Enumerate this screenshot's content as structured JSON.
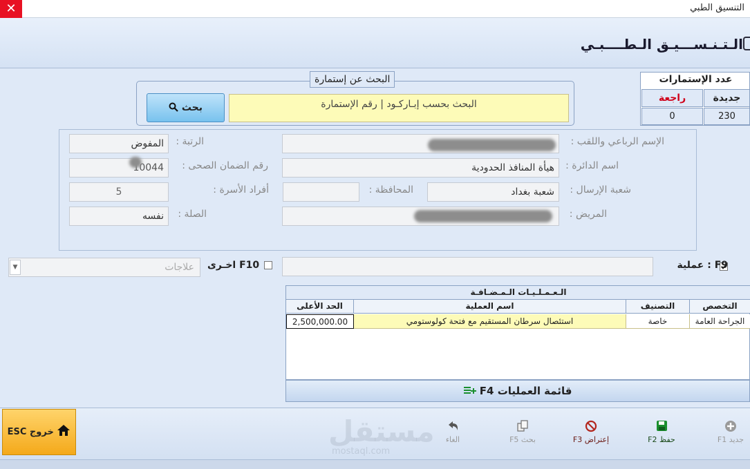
{
  "window": {
    "title": "التنسيق الطبي",
    "close_glyph": "✕"
  },
  "header": {
    "page_title": "الـتـنـســـيـق الـطــــبـي"
  },
  "form_count": {
    "title": "عدد الإستمارات",
    "new_label": "جديدة",
    "returned_label": "راجعة",
    "new_value": "230",
    "returned_value": "0",
    "returned_color": "#d0021b"
  },
  "search": {
    "legend": "البحث عن إستمارة",
    "placeholder": "البحث بحسب  إبـاركـود | رقم الإستمارة",
    "button_label": "بحث",
    "icon": "magnifier-icon"
  },
  "details": {
    "full_name_label": "الإسم الرباعي واللقب :",
    "rank_label": "الرتبة :",
    "rank_value": "المفوض",
    "department_label": "اسم الدائرة :",
    "department_value": "هيأة المنافذ الحدودية",
    "insurance_label": "رقم الضمان الصحى :",
    "insurance_value": "10044",
    "branch_label": "شعبة الإرسال :",
    "branch_value": "شعبة بغداد",
    "province_label": "المحافظة :",
    "family_label": "أفراد الأسرة :",
    "family_value": "5",
    "patient_label": "المريض :",
    "relation_label": "الصلة :",
    "relation_value": "نفسه"
  },
  "operation": {
    "key": "F9",
    "label": "عملية",
    "checked": true,
    "other_key": "F10",
    "other_label": "اخـرى",
    "treatments_placeholder": "علاجات"
  },
  "ops_grid": {
    "title": "الـعـمـلـيـات الـمـضـافـة",
    "columns": [
      "التخصص",
      "التصنيف",
      "اسم العملية",
      "الحد الأعلى"
    ],
    "rows": [
      [
        "الجراحة العامة",
        "خاصة",
        "استئصال سرطان المستقيم مع فتحة كولوستومي",
        "2,500,000.00"
      ]
    ]
  },
  "ops_list_button": {
    "label": "قائمة العمليات F4",
    "icon": "list-add-icon"
  },
  "toolbar": {
    "exit_label": "خروج ESC",
    "new_label": "جديد F1",
    "save_label": "حفظ F2",
    "objection_label": "إعتراض F3",
    "search_label": "بحث F5",
    "cancel_label": "الغاء",
    "accent_green": "#1a8f2e",
    "accent_red": "#b3261e"
  },
  "watermark": {
    "text": "مستقل",
    "url": "mostaql.com"
  }
}
